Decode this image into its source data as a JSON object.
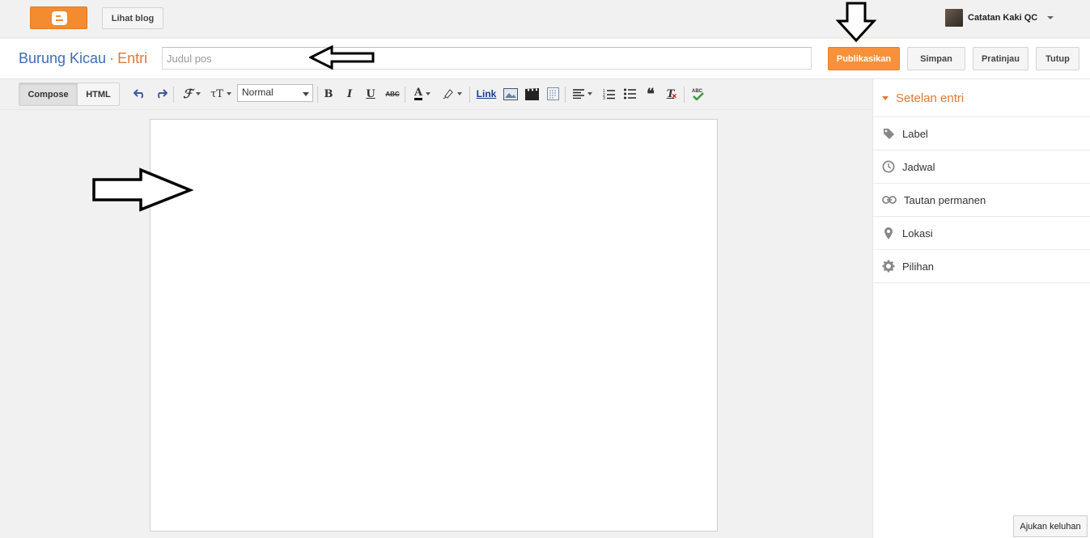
{
  "topbar": {
    "logo_icon": "blogger-logo-icon",
    "view_blog_label": "Lihat blog",
    "account_name": "Catatan Kaki QC"
  },
  "header": {
    "blog_name": "Burung Kicau",
    "separator": "·",
    "section": "Entri",
    "title_placeholder": "Judul pos",
    "title_value": "",
    "publish_label": "Publikasikan",
    "save_label": "Simpan",
    "preview_label": "Pratinjau",
    "close_label": "Tutup",
    "publish_color": "#f8913a"
  },
  "toolbar": {
    "compose_label": "Compose",
    "html_label": "HTML",
    "format_value": "Normal",
    "link_label": "Link",
    "icons": [
      "undo-icon",
      "redo-icon",
      "font-family-icon",
      "font-size-icon",
      "bold-icon",
      "italic-icon",
      "underline-icon",
      "strikethrough-icon",
      "text-color-icon",
      "highlight-icon",
      "link-icon",
      "image-icon",
      "video-icon",
      "jump-break-icon",
      "align-icon",
      "numbered-list-icon",
      "bulleted-list-icon",
      "quote-icon",
      "clear-formatting-icon",
      "spellcheck-icon"
    ]
  },
  "sidebar": {
    "title": "Setelan entri",
    "items": [
      {
        "label": "Label",
        "icon": "tag-icon"
      },
      {
        "label": "Jadwal",
        "icon": "clock-icon"
      },
      {
        "label": "Tautan permanen",
        "icon": "link-icon"
      },
      {
        "label": "Lokasi",
        "icon": "location-pin-icon"
      },
      {
        "label": "Pilihan",
        "icon": "gear-icon"
      }
    ]
  },
  "feedback_label": "Ajukan keluhan",
  "accent_color": "#dd7a36",
  "link_color": "#3d6eb5"
}
